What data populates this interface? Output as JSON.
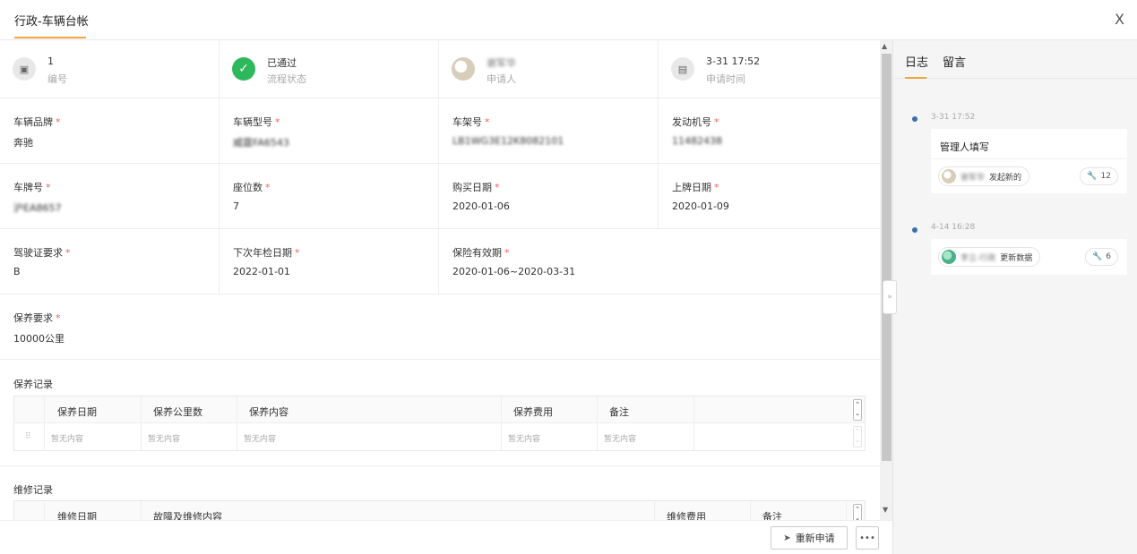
{
  "header": {
    "title": "行政-车辆台帐",
    "close_glyph": "X"
  },
  "summary": [
    {
      "value": "1",
      "label": "编号",
      "icon": "id-card-icon"
    },
    {
      "value": "已通过",
      "label": "流程状态",
      "icon": "check-circle-icon"
    },
    {
      "value": "谢军华",
      "label": "申请人",
      "icon": "avatar"
    },
    {
      "value": "3-31 17:52",
      "label": "申请时间",
      "icon": "calendar-icon"
    }
  ],
  "fields": {
    "brand": {
      "label": "车辆品牌",
      "value": "奔驰"
    },
    "model": {
      "label": "车辆型号",
      "value": "威霆FA6543"
    },
    "frame": {
      "label": "车架号",
      "value": "LB1WG3E12K8082101"
    },
    "engine": {
      "label": "发动机号",
      "value": "11482438"
    },
    "plate": {
      "label": "车牌号",
      "value": "沪EA8657"
    },
    "seats": {
      "label": "座位数",
      "value": "7"
    },
    "purchase": {
      "label": "购买日期",
      "value": "2020-01-06"
    },
    "register": {
      "label": "上牌日期",
      "value": "2020-01-09"
    },
    "license": {
      "label": "驾驶证要求",
      "value": "B"
    },
    "inspection": {
      "label": "下次年检日期",
      "value": "2022-01-01"
    },
    "insurance": {
      "label": "保险有效期",
      "value": "2020-01-06~2020-03-31"
    },
    "maintenance_req": {
      "label": "保养要求",
      "value": "10000公里"
    }
  },
  "required_mark": "*",
  "maintenance": {
    "title": "保养记录",
    "columns": [
      "保养日期",
      "保养公里数",
      "保养内容",
      "保养费用",
      "备注"
    ],
    "empty": "暂无内容"
  },
  "repair": {
    "title": "维修记录",
    "columns": [
      "维修日期",
      "故障及维修内容",
      "维修费用",
      "备注"
    ]
  },
  "footer": {
    "reapply_label": "重新申请",
    "more_label": "•••"
  },
  "panel": {
    "tabs": [
      "日志",
      "留言"
    ],
    "entries": [
      {
        "time": "3-31 17:52",
        "title": "管理人填写",
        "user": "谢军华",
        "action": "发起新的",
        "count": "12"
      },
      {
        "time": "4-14 16:28",
        "user": "李立-行政",
        "action": "更新数据",
        "count": "6"
      }
    ]
  }
}
